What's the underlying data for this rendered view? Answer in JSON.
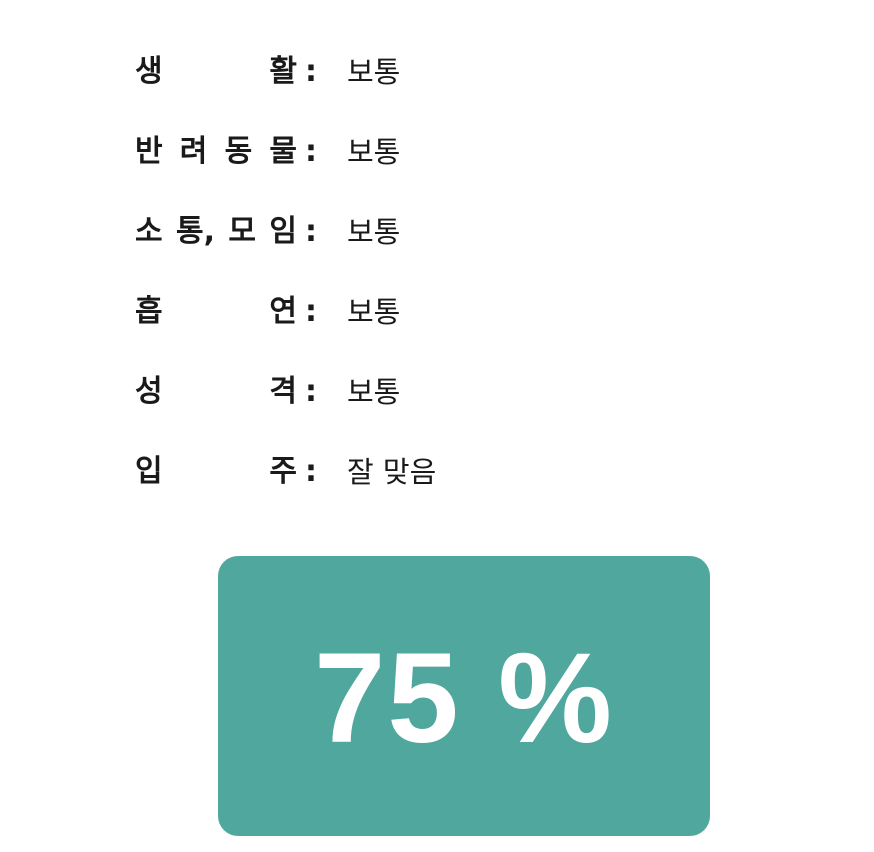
{
  "criteria": [
    {
      "label_chars": [
        "생",
        "활"
      ],
      "value": "보통"
    },
    {
      "label_chars": [
        "반",
        "려",
        "동",
        "물"
      ],
      "value": "보통"
    },
    {
      "label_chars": [
        "소",
        "통,",
        "모",
        "임"
      ],
      "value": "보통"
    },
    {
      "label_chars": [
        "흡",
        "연"
      ],
      "value": "보통"
    },
    {
      "label_chars": [
        "성",
        "격"
      ],
      "value": "보통"
    },
    {
      "label_chars": [
        "입",
        "주"
      ],
      "value": "잘 맞음"
    }
  ],
  "separator": ":",
  "match": {
    "percent_text": "75 %",
    "percent_value": 75,
    "box_color": "#4fa79e"
  }
}
